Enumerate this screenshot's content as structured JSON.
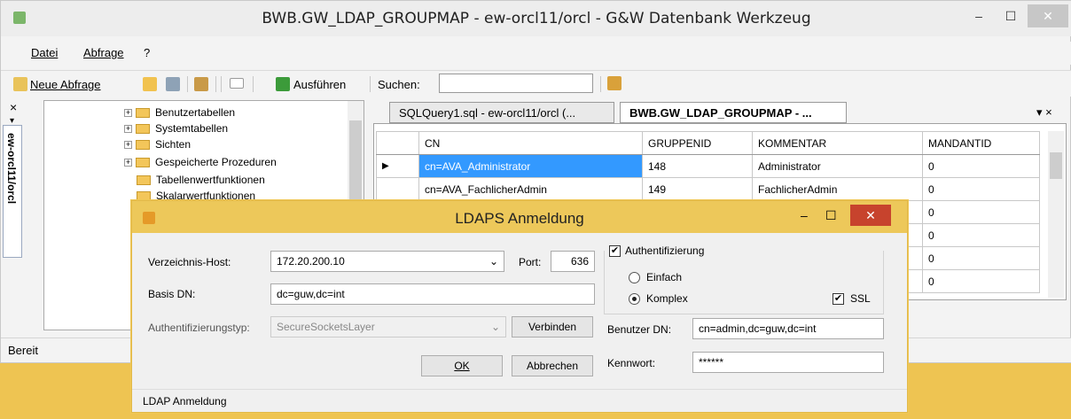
{
  "window": {
    "title": "BWB.GW_LDAP_GROUPMAP - ew-orcl11/orcl - G&W Datenbank Werkzeug",
    "minimize": "–",
    "maximize": "☐",
    "close": "✕"
  },
  "menu": {
    "items": [
      "Datei",
      "Abfrage",
      "?"
    ]
  },
  "toolbar": {
    "new_query": "Neue Abfrage",
    "execute": "Ausführen",
    "search_label": "Suchen:",
    "search_value": ""
  },
  "sidebar": {
    "close": "×",
    "pin": "▾",
    "connection_tab": "ew-orcl11/orcl"
  },
  "tree": {
    "items": [
      "Benutzertabellen",
      "Systemtabellen",
      "Sichten",
      "Gespeicherte Prozeduren",
      "Tabellenwertfunktionen",
      "Skalarwertfunktionen"
    ]
  },
  "tabs": [
    {
      "label": "SQLQuery1.sql - ew-orcl11/orcl (..."
    },
    {
      "label": "BWB.GW_LDAP_GROUPMAP - ..."
    }
  ],
  "tabs_menu": "▾ ×",
  "grid": {
    "columns": [
      "CN",
      "GRUPPENID",
      "KOMMENTAR",
      "MANDANTID"
    ],
    "rows": [
      [
        "cn=AVA_Administrator",
        "148",
        "Administrator",
        "0"
      ],
      [
        "cn=AVA_FachlicherAdmin",
        "149",
        "FachlicherAdmin",
        "0"
      ],
      [
        "",
        "",
        "",
        "0"
      ],
      [
        "",
        "",
        "",
        "0"
      ],
      [
        "",
        "",
        "",
        "0"
      ],
      [
        "",
        "",
        "",
        "0"
      ]
    ]
  },
  "status": {
    "text": "Bereit"
  },
  "dialog": {
    "title": "LDAPS Anmeldung",
    "minimize": "–",
    "maximize": "☐",
    "close": "✕",
    "host_label": "Verzeichnis-Host:",
    "host_value": "172.20.200.10",
    "port_label": "Port:",
    "port_value": "636",
    "basedn_label": "Basis DN:",
    "basedn_value": "dc=guw,dc=int",
    "authtype_label": "Authentifizierungstyp:",
    "authtype_value": "SecureSocketsLayer",
    "connect_button": "Verbinden",
    "ok_button": "OK",
    "cancel_button": "Abbrechen",
    "auth_checkbox": "Authentifizierung",
    "simple_radio": "Einfach",
    "complex_radio": "Komplex",
    "ssl_checkbox": "SSL",
    "userdn_label": "Benutzer DN:",
    "userdn_value": "cn=admin,dc=guw,dc=int",
    "password_label": "Kennwort:",
    "password_value": "******",
    "status": "LDAP Anmeldung",
    "check_mark": "✔"
  }
}
